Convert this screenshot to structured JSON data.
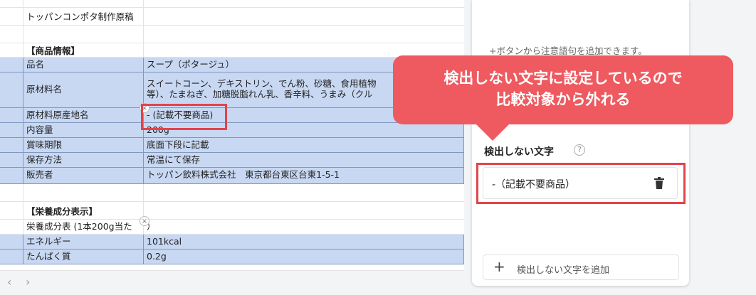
{
  "sheet": {
    "title": "トッパンコンポタ制作原稿",
    "section_product": "【商品情報】",
    "product_rows": [
      {
        "label": "品名",
        "value": "スープ（ポタージュ）"
      },
      {
        "label": "原材料名",
        "value": "スイートコーン、デキストリン、でん粉、砂糖、食用植物",
        "value2": "等）、たまねぎ、加糖脱脂れん乳、香辛料、うまみ（クル"
      },
      {
        "label": "原材料原産地名",
        "value": "- (記載不要商品)"
      },
      {
        "label": "内容量",
        "value": "200g"
      },
      {
        "label": "賞味期限",
        "value": "底面下段に記載"
      },
      {
        "label": "保存方法",
        "value": "常温にて保存"
      },
      {
        "label": "販売者",
        "value": "トッパン飲料株式会社　東京都台東区台東1-5-1"
      }
    ],
    "section_nutrition": "【栄養成分表示】",
    "nutrition_rows": [
      {
        "label": "栄養成分表 (1本200g当た",
        "value": "）"
      },
      {
        "label": "エネルギー",
        "value": "101kcal"
      },
      {
        "label": "たんぱく質",
        "value": "0.2g"
      }
    ]
  },
  "nav": {
    "prev": "‹",
    "next": "›"
  },
  "panel": {
    "hint": "+ボタンから注意語句を追加できます。",
    "ignore_title": "検出しない文字",
    "help_icon": "?",
    "ignore_words": [
      "-（記載不要商品）"
    ],
    "add_label": "検出しない文字を追加",
    "add_icon": "+"
  },
  "callout": {
    "line1": "検出しない文字に設定しているので",
    "line2": "比較対象から外れる"
  },
  "colors": {
    "highlight": "#c8d8f2",
    "annotation_red": "#e3434a",
    "callout_bg": "#ee5a5f"
  }
}
